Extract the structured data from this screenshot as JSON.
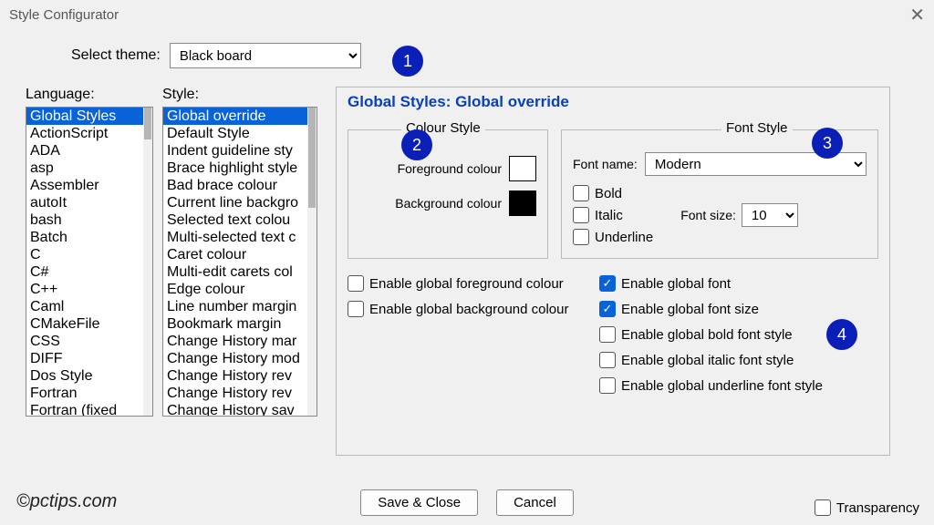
{
  "window": {
    "title": "Style Configurator"
  },
  "theme": {
    "label": "Select theme:",
    "value": "Black board"
  },
  "lists": {
    "language_label": "Language:",
    "style_label": "Style:",
    "languages": [
      "Global Styles",
      "ActionScript",
      "ADA",
      "asp",
      "Assembler",
      "autoIt",
      "bash",
      "Batch",
      "C",
      "C#",
      "C++",
      "Caml",
      "CMakeFile",
      "CSS",
      "DIFF",
      "Dos Style",
      "Fortran",
      "Fortran (fixed"
    ],
    "styles": [
      "Global override",
      "Default Style",
      "Indent guideline sty",
      "Brace highlight style",
      "Bad brace colour",
      "Current line backgro",
      "Selected text colou",
      "Multi-selected text c",
      "Caret colour",
      "Multi-edit carets col",
      "Edge colour",
      "Line number margin",
      "Bookmark margin",
      "Change History mar",
      "Change History mod",
      "Change History rev",
      "Change History rev",
      "Change History sav"
    ]
  },
  "section": {
    "title": "Global Styles: Global override"
  },
  "colour": {
    "legend": "Colour Style",
    "fg_label": "Foreground colour",
    "bg_label": "Background colour"
  },
  "font": {
    "legend": "Font Style",
    "name_label": "Font name:",
    "name_value": "Modern",
    "bold": "Bold",
    "italic": "Italic",
    "underline": "Underline",
    "size_label": "Font size:",
    "size_value": "10"
  },
  "globals": {
    "fg": "Enable global foreground colour",
    "bg": "Enable global background colour",
    "font": "Enable global font",
    "size": "Enable global font size",
    "bold": "Enable global bold font style",
    "italic": "Enable global italic font style",
    "underline": "Enable global underline font style"
  },
  "buttons": {
    "save": "Save & Close",
    "cancel": "Cancel"
  },
  "transparency": {
    "label": "Transparency"
  },
  "markers": {
    "m1": "1",
    "m2": "2",
    "m3": "3",
    "m4": "4"
  },
  "watermark": "©pctips.com"
}
